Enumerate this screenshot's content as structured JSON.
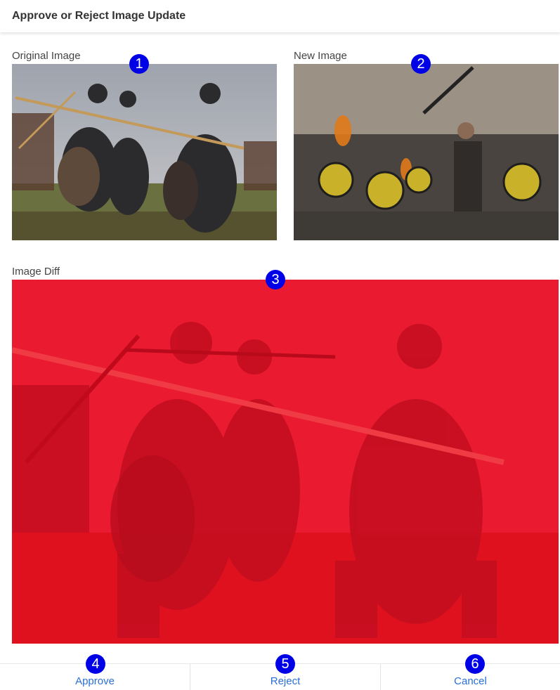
{
  "dialog": {
    "title": "Approve or Reject Image Update"
  },
  "panels": {
    "original_label": "Original Image",
    "new_label": "New Image",
    "diff_label": "Image Diff"
  },
  "markers": [
    "1",
    "2",
    "3",
    "4",
    "5",
    "6"
  ],
  "actions": {
    "approve": "Approve",
    "reject": "Reject",
    "cancel": "Cancel"
  },
  "colors": {
    "marker": "#0000e6",
    "link": "#2a6fd6",
    "diff_overlay": "#e8142a"
  }
}
